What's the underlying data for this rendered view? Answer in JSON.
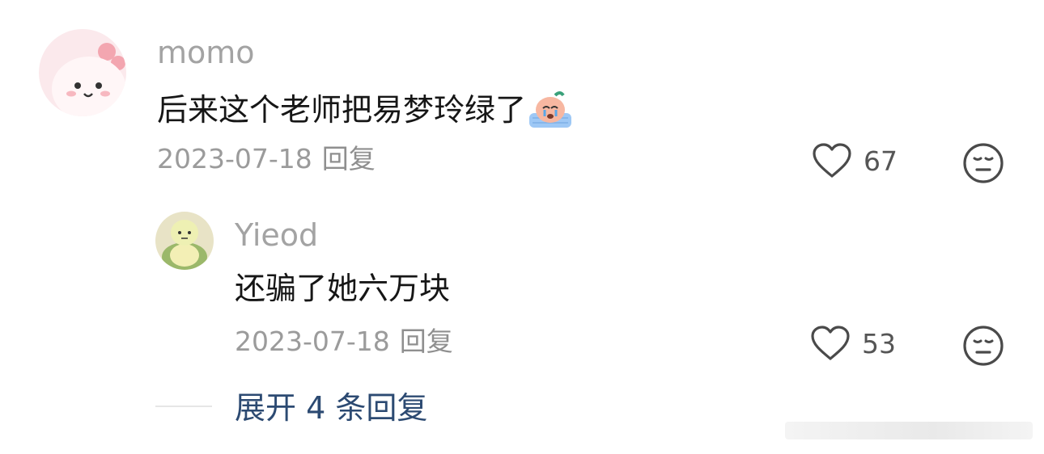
{
  "comment": {
    "username": "momo",
    "text": "后来这个老师把易梦玲绿了",
    "date": "2023-07-18",
    "reply_label": "回复",
    "likes": "67",
    "inline_emoji": "crying-sticker-icon"
  },
  "reply": {
    "username": "Yieod",
    "text": "还骗了她六万块",
    "date": "2023-07-18",
    "reply_label": "回复",
    "likes": "53"
  },
  "expand_label": "展开 4 条回复",
  "colors": {
    "username": "#a3a3a3",
    "text": "#161616",
    "meta": "#9b9b9b",
    "link": "#2c4a72"
  }
}
